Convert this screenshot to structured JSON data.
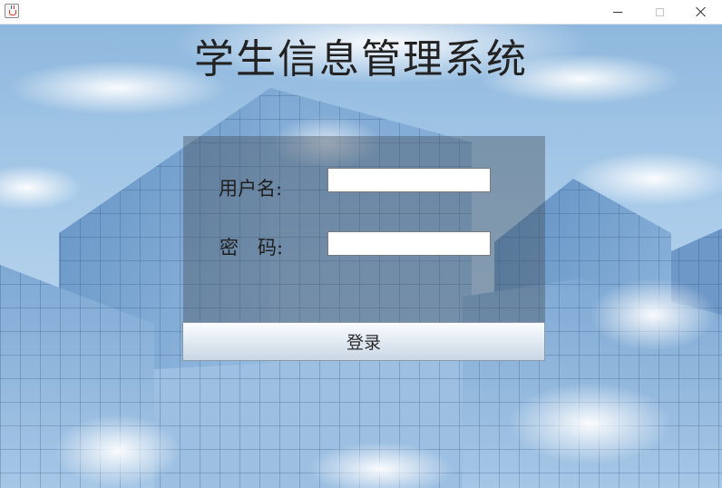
{
  "window": {
    "icon": "java-cup-icon",
    "controls": [
      "minimize-icon",
      "maximize-icon",
      "close-icon"
    ]
  },
  "app": {
    "title": "学生信息管理系统"
  },
  "login": {
    "username_label": "用户名:",
    "username_value": "",
    "password_label": "密　码:",
    "password_value": "",
    "submit_label": "登录"
  },
  "colors": {
    "panel_overlay": "#46505c",
    "sky": "#a9cbe9",
    "glass": "#6f9ccc"
  }
}
